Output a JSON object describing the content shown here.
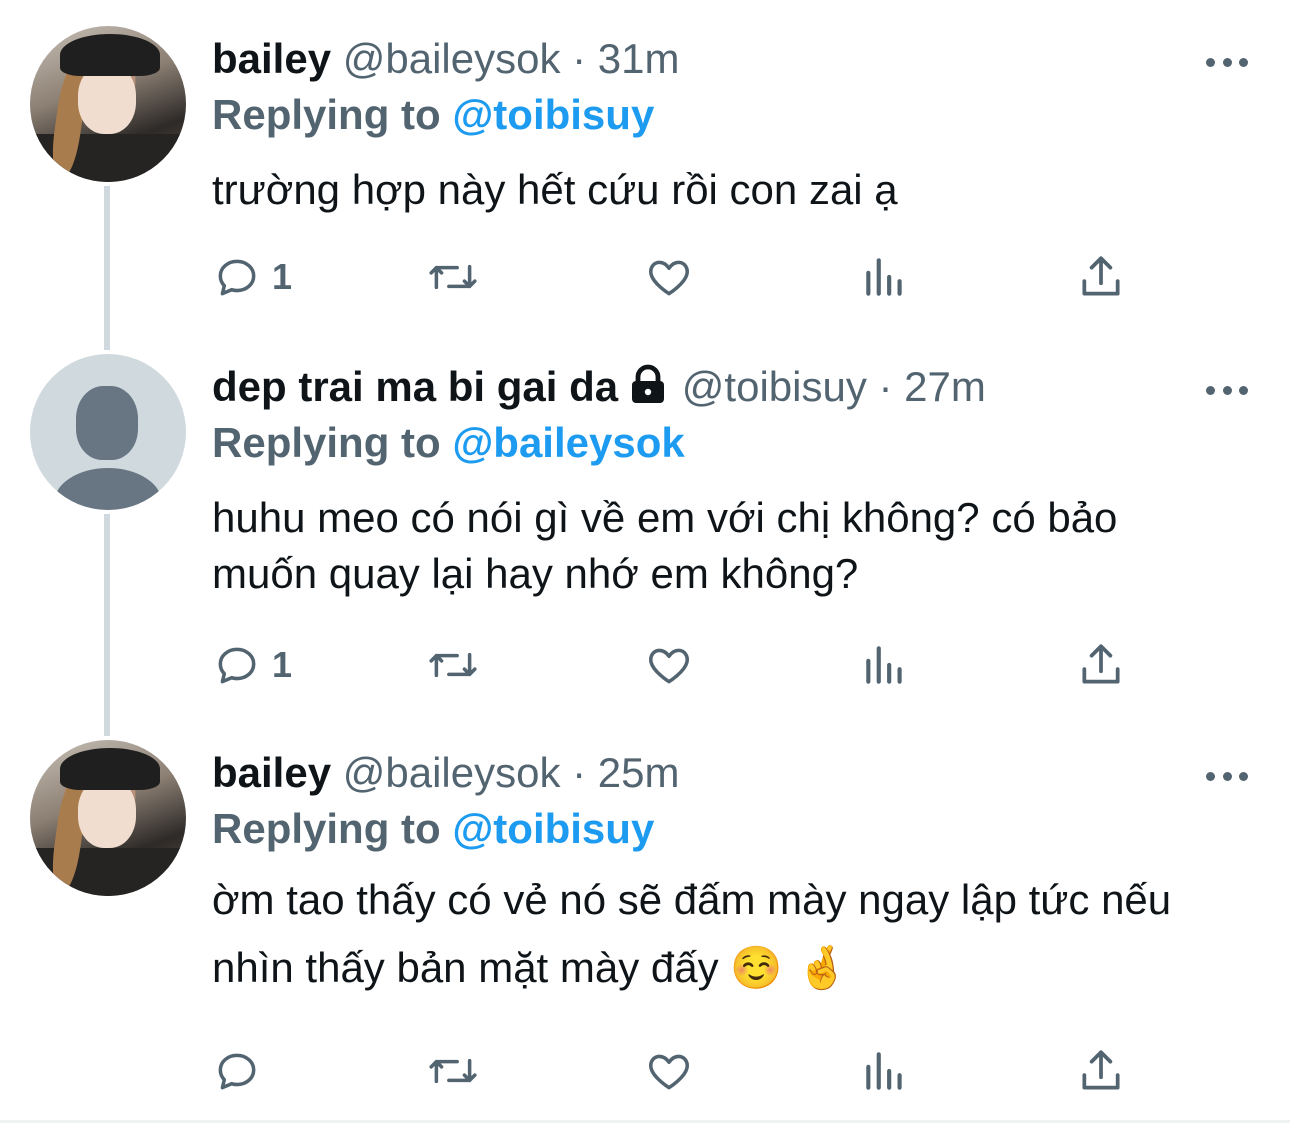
{
  "tweets": [
    {
      "name": "bailey",
      "handle": "@baileysok",
      "time": "· 31m",
      "replying_prefix": "Replying to",
      "replying_handle": "@toibisuy",
      "text": "trường hợp này hết cứu rồi con zai ạ",
      "reply_count": "1"
    },
    {
      "name": "dep trai ma bi gai da",
      "handle": "@toibisuy",
      "time": "· 27m",
      "replying_prefix": "Replying to",
      "replying_handle": "@baileysok",
      "text": "huhu meo có nói gì về em với chị không? có bảo muốn quay lại hay nhớ em không?",
      "reply_count": "1"
    },
    {
      "name": "bailey",
      "handle": "@baileysok",
      "time": "· 25m",
      "replying_prefix": "Replying to",
      "replying_handle": "@toibisuy",
      "text": "ờm tao thấy có vẻ nó sẽ đấm mày ngay lập tức nếu nhìn thấy bản mặt mày đấy",
      "emoji": "☺️ 🤞",
      "reply_count": ""
    }
  ],
  "icons": {
    "reply": "reply-icon",
    "retweet": "retweet-icon",
    "like": "heart-icon",
    "views": "analytics-icon",
    "share": "share-icon",
    "more": "more-icon",
    "lock": "lock-icon"
  },
  "colors": {
    "link": "#1d9bf0",
    "secondary": "#536471",
    "thread_line": "#cfd9de"
  }
}
